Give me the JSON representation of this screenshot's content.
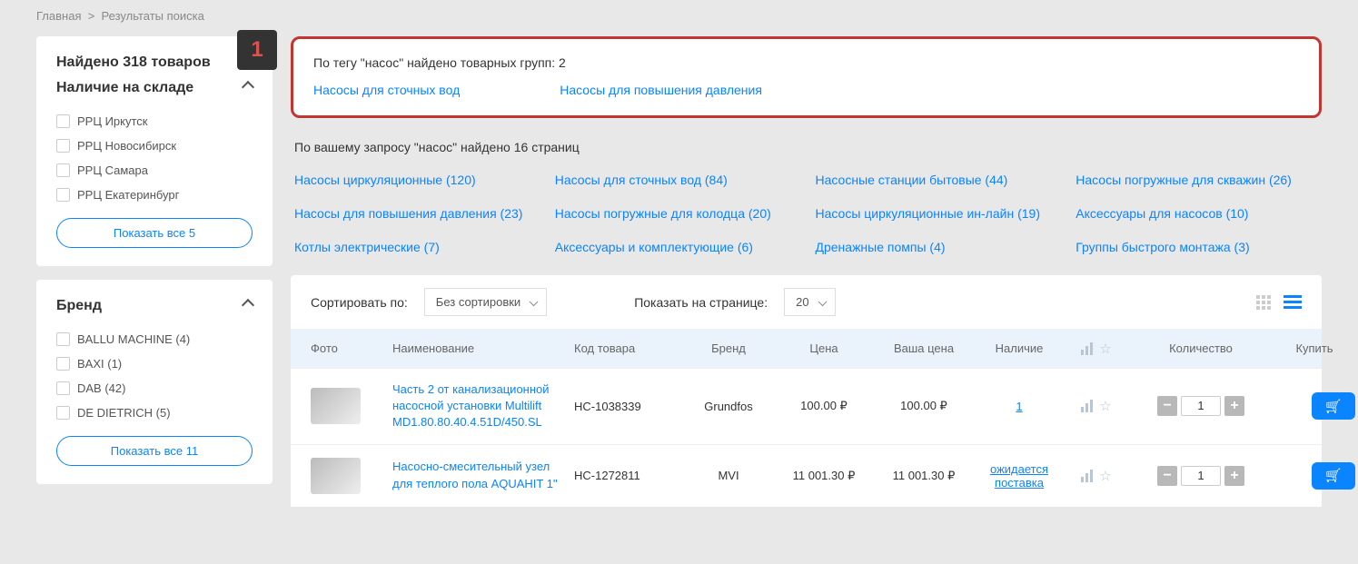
{
  "breadcrumb": {
    "home": "Главная",
    "sep": ">",
    "current": "Результаты поиска"
  },
  "sidebar": {
    "found": "Найдено 318 товаров",
    "stock_title": "Наличие на складе",
    "stock_items": [
      "РРЦ Иркутск",
      "РРЦ Новосибирск",
      "РРЦ Самара",
      "РРЦ Екатеринбург"
    ],
    "stock_show_all": "Показать все 5",
    "brand_title": "Бренд",
    "brand_items": [
      "BALLU MACHINE (4)",
      "BAXI (1)",
      "DAB (42)",
      "DE DIETRICH (5)"
    ],
    "brand_show_all": "Показать все 11"
  },
  "badge": "1",
  "tagbox": {
    "heading": "По тегу \"насос\" найдено товарных групп: 2",
    "links": [
      "Насосы для сточных вод",
      "Насосы для повышения давления"
    ]
  },
  "pages_heading": "По вашему запросу \"насос\" найдено 16 страниц",
  "page_links": [
    "Насосы циркуляционные (120)",
    "Насосы для сточных вод (84)",
    "Насосные станции бытовые (44)",
    "Насосы погружные для скважин (26)",
    "Насосы для повышения давления (23)",
    "Насосы погружные для колодца (20)",
    "Насосы циркуляционные ин-лайн (19)",
    "Аксессуары для насосов (10)",
    "Котлы электрические (7)",
    "Аксессуары и комплектующие (6)",
    "Дренажные помпы (4)",
    "Группы быстрого монтажа (3)"
  ],
  "toolbar": {
    "sort_lbl": "Сортировать по:",
    "sort_val": "Без сортировки",
    "perpage_lbl": "Показать на странице:",
    "perpage_val": "20"
  },
  "thead": {
    "photo": "Фото",
    "name": "Наименование",
    "code": "Код товара",
    "brand": "Бренд",
    "price": "Цена",
    "your_price": "Ваша цена",
    "stock": "Наличие",
    "icons": "",
    "qty": "Количество",
    "buy": "Купить"
  },
  "rows": [
    {
      "name": "Часть 2 от канализационной насосной установки Multilift MD1.80.80.40.4.51D/450.SL",
      "code": "НС-1038339",
      "brand": "Grundfos",
      "price": "100.00 ₽",
      "your_price": "100.00 ₽",
      "stock": "1",
      "qty": "1"
    },
    {
      "name": "Насосно-смесительный узел для теплого пола AQUAHIT 1\"",
      "code": "НС-1272811",
      "brand": "MVI",
      "price": "11 001.30 ₽",
      "your_price": "11 001.30 ₽",
      "stock": "ожидается поставка",
      "qty": "1"
    }
  ]
}
